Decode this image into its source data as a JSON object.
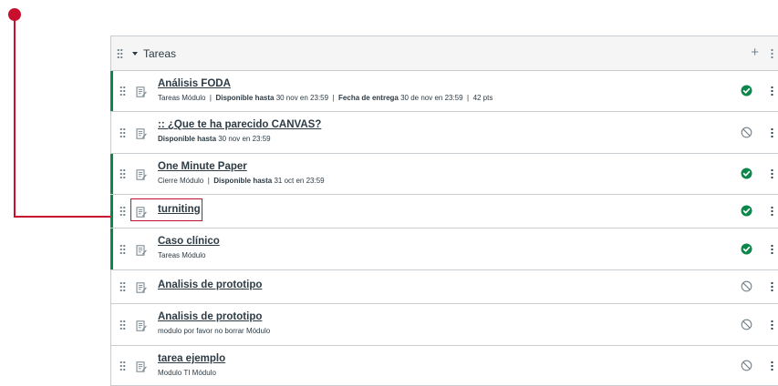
{
  "module": {
    "title": "Tareas",
    "items": [
      {
        "title": "Análisis FODA",
        "published": true,
        "meta": [
          {
            "label": "",
            "value": "Tareas Módulo"
          },
          {
            "label": "Disponible hasta",
            "value": "30 nov en 23:59"
          },
          {
            "label": "Fecha de entrega",
            "value": "30 de nov en 23:59"
          },
          {
            "label": "",
            "value": "42 pts"
          }
        ]
      },
      {
        "title": ":: ¿Que te ha parecido CANVAS?",
        "published": false,
        "meta": [
          {
            "label": "Disponible hasta",
            "value": "30 nov en 23:59"
          }
        ]
      },
      {
        "title": "One Minute Paper",
        "published": true,
        "meta": [
          {
            "label": "",
            "value": "Cierre Módulo"
          },
          {
            "label": "Disponible hasta",
            "value": "31 oct en 23:59"
          }
        ]
      },
      {
        "title": "turniting",
        "published": true,
        "meta": []
      },
      {
        "title": "Caso clínico",
        "published": true,
        "meta": [
          {
            "label": "",
            "value": "Tareas Módulo"
          }
        ]
      },
      {
        "title": "Analisis de prototipo",
        "published": false,
        "meta": []
      },
      {
        "title": "Analisis de prototipo",
        "published": false,
        "meta": [
          {
            "label": "",
            "value": "modulo por favor no borrar Módulo"
          }
        ]
      },
      {
        "title": "tarea ejemplo",
        "published": false,
        "meta": [
          {
            "label": "",
            "value": "Modulo TI Módulo"
          }
        ]
      }
    ]
  },
  "icons": {
    "header_add": "plus-icon",
    "header_menu": "kebab-menu-icon",
    "item_type": "assignment-icon",
    "published": "published-check-icon",
    "unpublished": "unpublished-icon",
    "item_menu": "kebab-menu-icon"
  },
  "colors": {
    "published": "#0b874b",
    "unpublished": "#73818a",
    "callout": "#c8102e",
    "header_bg": "#f5f5f5",
    "text": "#2d3b45"
  },
  "callout": {
    "highlighted_item": "turniting"
  }
}
